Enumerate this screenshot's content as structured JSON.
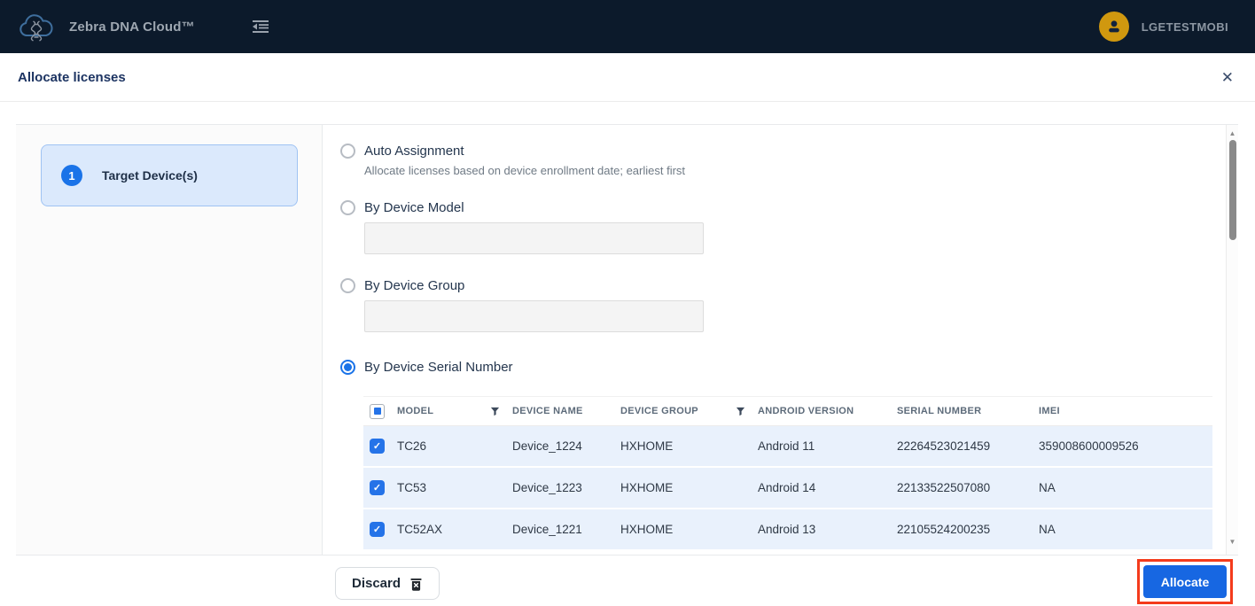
{
  "header": {
    "app_title": "Zebra DNA Cloud™",
    "username": "LGETESTMOBI"
  },
  "modal": {
    "title": "Allocate licenses"
  },
  "icons": {
    "close": "✕",
    "scroll_up": "▲",
    "scroll_down": "▼"
  },
  "stepper": {
    "step_number": "1",
    "step_label": "Target Device(s)"
  },
  "options": [
    {
      "label": "Auto Assignment",
      "description": "Allocate licenses based on device enrollment date; earliest first",
      "selected": false
    },
    {
      "label": "By Device Model",
      "input_value": "",
      "selected": false
    },
    {
      "label": "By Device Group",
      "input_value": "",
      "selected": false
    },
    {
      "label": "By Device Serial Number",
      "selected": true
    }
  ],
  "table": {
    "select_all_state": "indeterminate",
    "columns": [
      "MODEL",
      "DEVICE NAME",
      "DEVICE GROUP",
      "ANDROID VERSION",
      "SERIAL NUMBER",
      "IMEI"
    ],
    "filtered_columns": [
      "MODEL",
      "DEVICE GROUP"
    ],
    "rows": [
      {
        "checked": true,
        "model": "TC26",
        "device_name": "Device_1224",
        "device_group": "HXHOME",
        "android_version": "Android 11",
        "serial_number": "22264523021459",
        "imei": "359008600009526"
      },
      {
        "checked": true,
        "model": "TC53",
        "device_name": "Device_1223",
        "device_group": "HXHOME",
        "android_version": "Android 14",
        "serial_number": "22133522507080",
        "imei": "NA"
      },
      {
        "checked": true,
        "model": "TC52AX",
        "device_name": "Device_1221",
        "device_group": "HXHOME",
        "android_version": "Android 13",
        "serial_number": "22105524200235",
        "imei": "NA"
      }
    ]
  },
  "footer": {
    "discard_label": "Discard",
    "allocate_label": "Allocate"
  },
  "colors": {
    "header_bg": "#0c1a2b",
    "accent_blue": "#1a73e8",
    "row_bg": "#e9f1fc",
    "step_card_bg": "#dbe9fc",
    "step_card_border": "#9fc3f3",
    "avatar_orange": "#d0980f",
    "annotation_red": "#f43b1c"
  }
}
